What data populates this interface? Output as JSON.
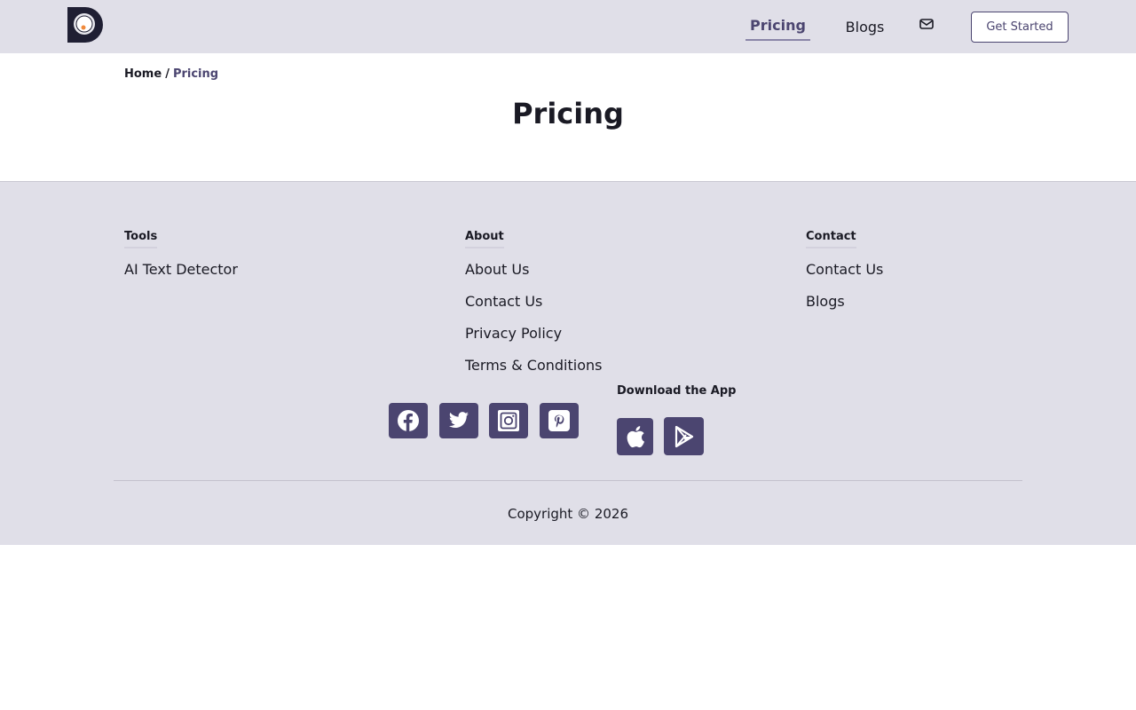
{
  "header": {
    "logo_icon": "d-logo-icon",
    "nav": {
      "pricing": "Pricing",
      "blogs": "Blogs"
    },
    "mail_icon": "envelope-icon",
    "cta_label": "Get Started"
  },
  "breadcrumb": {
    "home": "Home",
    "separator": "/",
    "current": "Pricing"
  },
  "page": {
    "title": "Pricing"
  },
  "footer": {
    "tools": {
      "title": "Tools",
      "links": [
        "AI Text Detector"
      ]
    },
    "about": {
      "title": "About",
      "links": [
        "About Us",
        "Contact Us",
        "Privacy Policy",
        "Terms & Conditions"
      ]
    },
    "contact": {
      "title": "Contact",
      "links": [
        "Contact Us",
        "Blogs"
      ]
    },
    "social_icons": [
      "facebook-icon",
      "twitter-icon",
      "instagram-icon",
      "pinterest-icon"
    ],
    "app": {
      "title": "Download the App",
      "icons": [
        "apple-icon",
        "google-play-icon"
      ]
    },
    "copyright": "Copyright © 2026"
  },
  "colors": {
    "accent": "#4b4570",
    "band": "#e0dfe8",
    "text": "#1a1a24"
  }
}
